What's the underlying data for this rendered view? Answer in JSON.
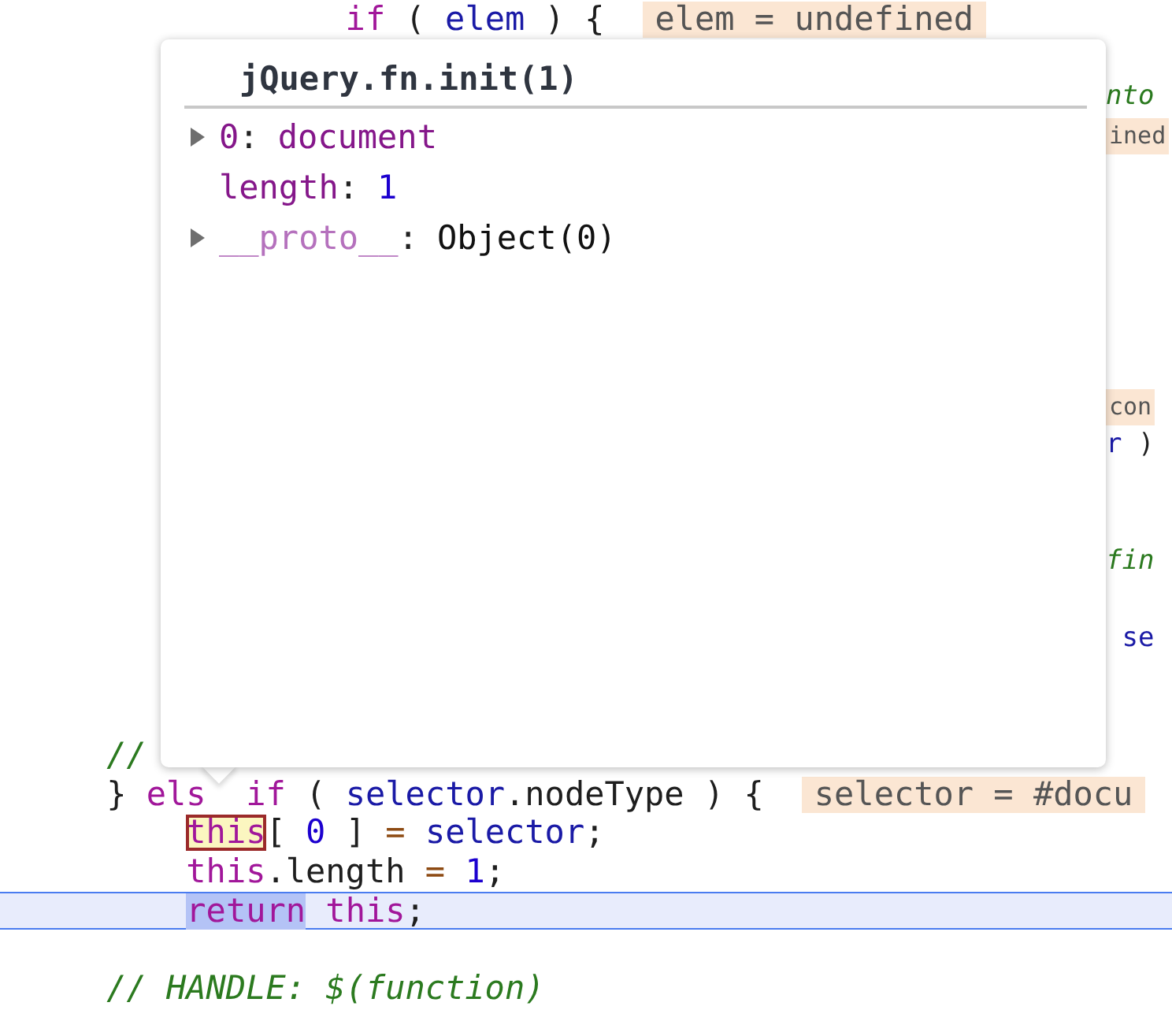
{
  "code_lines": [
    {
      "kind": "code",
      "left": [
        {
          "kind": "keyword",
          "text": "                if"
        },
        {
          "kind": "plain",
          "text": " ( "
        },
        {
          "kind": "variable",
          "text": "elem"
        },
        {
          "kind": "plain",
          "text": " ) {"
        },
        {
          "kind": "value",
          "text": "elem = undefined"
        }
      ]
    },
    {
      "kind": "blank"
    },
    {
      "kind": "code",
      "right": [
        {
          "kind": "comment",
          "text": "nto"
        }
      ]
    },
    {
      "kind": "code",
      "right": [
        {
          "kind": "value",
          "text": "ined"
        }
      ]
    },
    {
      "kind": "blank"
    },
    {
      "kind": "blank"
    },
    {
      "kind": "blank"
    },
    {
      "kind": "blank"
    },
    {
      "kind": "blank"
    },
    {
      "kind": "blank"
    },
    {
      "kind": "code",
      "right": [
        {
          "kind": "value",
          "text": "con"
        }
      ]
    },
    {
      "kind": "code",
      "right": [
        {
          "kind": "variable",
          "text": "r"
        },
        {
          "kind": "plain",
          "text": " )"
        }
      ]
    },
    {
      "kind": "blank"
    },
    {
      "kind": "blank"
    },
    {
      "kind": "code",
      "right": [
        {
          "kind": "comment",
          "text": "fin"
        }
      ]
    },
    {
      "kind": "blank"
    },
    {
      "kind": "code",
      "right": [
        {
          "kind": "variable",
          "text": " se"
        }
      ]
    },
    {
      "kind": "blank"
    },
    {
      "kind": "blank"
    },
    {
      "kind": "code",
      "left": [
        {
          "kind": "comment",
          "text": "    //"
        }
      ]
    },
    {
      "kind": "code",
      "left": [
        {
          "kind": "plain",
          "text": "    } "
        },
        {
          "kind": "keyword",
          "text": "els"
        },
        {
          "kind": "keyword",
          "text": "  if"
        },
        {
          "kind": "plain",
          "text": " ( "
        },
        {
          "kind": "variable",
          "text": "selector"
        },
        {
          "kind": "plain",
          "text": ".nodeType ) {"
        },
        {
          "kind": "value",
          "text": "selector = #docu"
        }
      ]
    },
    {
      "kind": "code",
      "left": [
        {
          "kind": "evaluated-keyword",
          "text": "        this"
        },
        {
          "kind": "plain",
          "text": "[ "
        },
        {
          "kind": "number",
          "text": "0"
        },
        {
          "kind": "plain",
          "text": " ] "
        },
        {
          "kind": "operator",
          "text": "="
        },
        {
          "kind": "variable",
          "text": " selector"
        },
        {
          "kind": "plain",
          "text": ";"
        }
      ]
    },
    {
      "kind": "code",
      "left": [
        {
          "kind": "keyword",
          "text": "        this"
        },
        {
          "kind": "plain",
          "text": ".length "
        },
        {
          "kind": "operator",
          "text": "="
        },
        {
          "kind": "number",
          "text": " 1"
        },
        {
          "kind": "plain",
          "text": ";"
        }
      ]
    }
  ],
  "paused_line": {
    "tokens": [
      {
        "kind": "selected-keyword",
        "text": "        return"
      },
      {
        "kind": "keyword",
        "text": " this"
      },
      {
        "kind": "plain",
        "text": ";"
      }
    ]
  },
  "code_lines_after": [
    {
      "kind": "blank"
    },
    {
      "kind": "code",
      "left": [
        {
          "kind": "comment",
          "text": "    // HANDLE: $(function)"
        }
      ]
    }
  ],
  "popover": {
    "title": "jQuery.fn.init(1)",
    "properties": [
      {
        "expandable": true,
        "key": "0",
        "internal": false,
        "separator": ":",
        "value": "document",
        "kind": "node"
      },
      {
        "expandable": false,
        "key": "length",
        "internal": false,
        "separator": ":",
        "value": "1",
        "kind": "number"
      },
      {
        "expandable": true,
        "key": "__proto__",
        "internal": true,
        "separator": ":",
        "value": "Object(0)",
        "kind": "object"
      }
    ]
  }
}
